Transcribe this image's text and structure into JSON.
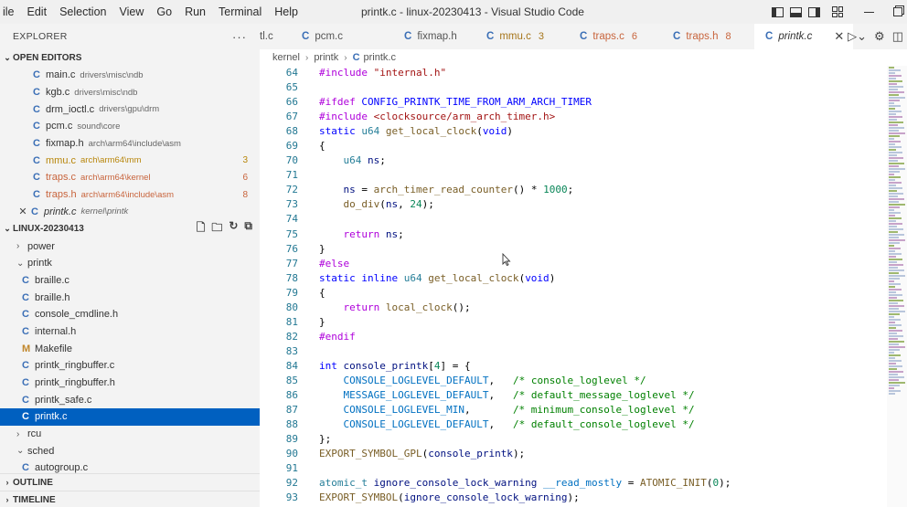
{
  "menu": [
    "ile",
    "Edit",
    "Selection",
    "View",
    "Go",
    "Run",
    "Terminal",
    "Help"
  ],
  "window_title": "printk.c - linux-20230413 - Visual Studio Code",
  "sidebar": {
    "title": "EXPLORER",
    "more": "···",
    "open_editors": {
      "label": "OPEN EDITORS",
      "items": [
        {
          "icon": "C",
          "name": "main.c",
          "path": "drivers\\misc\\ndb",
          "badge": "",
          "state": ""
        },
        {
          "icon": "C",
          "name": "kgb.c",
          "path": "drivers\\misc\\ndb",
          "badge": "",
          "state": ""
        },
        {
          "icon": "C",
          "name": "drm_ioctl.c",
          "path": "drivers\\gpu\\drm",
          "badge": "",
          "state": ""
        },
        {
          "icon": "C",
          "name": "pcm.c",
          "path": "sound\\core",
          "badge": "",
          "state": ""
        },
        {
          "icon": "C",
          "name": "fixmap.h",
          "path": "arch\\arm64\\include\\asm",
          "badge": "",
          "state": ""
        },
        {
          "icon": "C",
          "name": "mmu.c",
          "path": "arch\\arm64\\mm",
          "badge": "3",
          "state": "warn"
        },
        {
          "icon": "C",
          "name": "traps.c",
          "path": "arch\\arm64\\kernel",
          "badge": "6",
          "state": "err"
        },
        {
          "icon": "C",
          "name": "traps.h",
          "path": "arch\\arm64\\include\\asm",
          "badge": "8",
          "state": "err"
        },
        {
          "icon": "C",
          "name": "printk.c",
          "path": "kernel\\printk",
          "badge": "",
          "state": "active",
          "close": "✕"
        }
      ]
    },
    "workspace": {
      "label": "LINUX-20230413",
      "tree": [
        {
          "kind": "folder",
          "name": "power",
          "open": false,
          "depth": 1
        },
        {
          "kind": "folder",
          "name": "printk",
          "open": true,
          "depth": 1
        },
        {
          "kind": "file",
          "icon": "C",
          "name": "braille.c",
          "depth": 2
        },
        {
          "kind": "file",
          "icon": "C",
          "name": "braille.h",
          "depth": 2
        },
        {
          "kind": "file",
          "icon": "C",
          "name": "console_cmdline.h",
          "depth": 2
        },
        {
          "kind": "file",
          "icon": "C",
          "name": "internal.h",
          "depth": 2
        },
        {
          "kind": "file",
          "icon": "M",
          "name": "Makefile",
          "depth": 2
        },
        {
          "kind": "file",
          "icon": "C",
          "name": "printk_ringbuffer.c",
          "depth": 2
        },
        {
          "kind": "file",
          "icon": "C",
          "name": "printk_ringbuffer.h",
          "depth": 2
        },
        {
          "kind": "file",
          "icon": "C",
          "name": "printk_safe.c",
          "depth": 2
        },
        {
          "kind": "file",
          "icon": "C",
          "name": "printk.c",
          "depth": 2,
          "selected": true
        },
        {
          "kind": "folder",
          "name": "rcu",
          "open": false,
          "depth": 1
        },
        {
          "kind": "folder",
          "name": "sched",
          "open": true,
          "depth": 1
        },
        {
          "kind": "file",
          "icon": "C",
          "name": "autogroup.c",
          "depth": 2
        }
      ]
    },
    "outline_label": "OUTLINE",
    "timeline_label": "TIMELINE"
  },
  "tabs": [
    {
      "label": "tl.c",
      "icon": "",
      "badge": "",
      "state": ""
    },
    {
      "label": "pcm.c",
      "icon": "C",
      "badge": "",
      "state": ""
    },
    {
      "label": "fixmap.h",
      "icon": "C",
      "badge": "",
      "state": ""
    },
    {
      "label": "mmu.c",
      "icon": "C",
      "badge": "3",
      "state": "warn"
    },
    {
      "label": "traps.c",
      "icon": "C",
      "badge": "6",
      "state": "err"
    },
    {
      "label": "traps.h",
      "icon": "C",
      "badge": "8",
      "state": "err"
    },
    {
      "label": "printk.c",
      "icon": "C",
      "badge": "",
      "state": "active",
      "close": "✕"
    }
  ],
  "breadcrumb": {
    "parts": [
      "kernel",
      "printk"
    ],
    "file": "printk.c",
    "icon": "C"
  },
  "code": [
    {
      "n": "64",
      "t": [
        [
          "pp",
          "#include "
        ],
        [
          "str",
          "\"internal.h\""
        ]
      ]
    },
    {
      "n": "65",
      "t": []
    },
    {
      "n": "66",
      "t": [
        [
          "pp",
          "#ifdef "
        ],
        [
          "ppname",
          "CONFIG_PRINTK_TIME_FROM_ARM_ARCH_TIMER"
        ]
      ]
    },
    {
      "n": "67",
      "t": [
        [
          "pp",
          "#include "
        ],
        [
          "str",
          "<clocksource/arm_arch_timer.h>"
        ]
      ]
    },
    {
      "n": "68",
      "t": [
        [
          "kw",
          "static "
        ],
        [
          "ty",
          "u64 "
        ],
        [
          "fn",
          "get_local_clock"
        ],
        [
          "plain2",
          "("
        ],
        [
          "kw",
          "void"
        ],
        [
          "plain2",
          ")"
        ]
      ]
    },
    {
      "n": "69",
      "t": [
        [
          "plain2",
          "{"
        ]
      ]
    },
    {
      "n": "70",
      "t": [
        [
          "plain2",
          "    "
        ],
        [
          "ty",
          "u64 "
        ],
        [
          "plain",
          "ns"
        ],
        [
          "plain2",
          ";"
        ]
      ]
    },
    {
      "n": "71",
      "t": []
    },
    {
      "n": "72",
      "t": [
        [
          "plain2",
          "    "
        ],
        [
          "plain",
          "ns"
        ],
        [
          "plain2",
          " = "
        ],
        [
          "fn",
          "arch_timer_read_counter"
        ],
        [
          "plain2",
          "() * "
        ],
        [
          "num",
          "1000"
        ],
        [
          "plain2",
          ";"
        ]
      ]
    },
    {
      "n": "73",
      "t": [
        [
          "plain2",
          "    "
        ],
        [
          "fn",
          "do_div"
        ],
        [
          "plain2",
          "("
        ],
        [
          "plain",
          "ns"
        ],
        [
          "plain2",
          ", "
        ],
        [
          "num",
          "24"
        ],
        [
          "plain2",
          ");"
        ]
      ]
    },
    {
      "n": "74",
      "t": []
    },
    {
      "n": "75",
      "t": [
        [
          "plain2",
          "    "
        ],
        [
          "pp",
          "return "
        ],
        [
          "plain",
          "ns"
        ],
        [
          "plain2",
          ";"
        ]
      ]
    },
    {
      "n": "76",
      "t": [
        [
          "plain2",
          "}"
        ]
      ]
    },
    {
      "n": "77",
      "t": [
        [
          "pp",
          "#else"
        ]
      ]
    },
    {
      "n": "78",
      "t": [
        [
          "kw",
          "static inline "
        ],
        [
          "ty",
          "u64 "
        ],
        [
          "fn",
          "get_local_clock"
        ],
        [
          "plain2",
          "("
        ],
        [
          "kw",
          "void"
        ],
        [
          "plain2",
          ")"
        ]
      ]
    },
    {
      "n": "79",
      "t": [
        [
          "plain2",
          "{"
        ]
      ]
    },
    {
      "n": "80",
      "t": [
        [
          "plain2",
          "    "
        ],
        [
          "pp",
          "return "
        ],
        [
          "fn",
          "local_clock"
        ],
        [
          "plain2",
          "();"
        ]
      ]
    },
    {
      "n": "81",
      "t": [
        [
          "plain2",
          "}"
        ]
      ]
    },
    {
      "n": "82",
      "t": [
        [
          "pp",
          "#endif"
        ]
      ]
    },
    {
      "n": "83",
      "t": []
    },
    {
      "n": "84",
      "t": [
        [
          "kw",
          "int "
        ],
        [
          "plain",
          "console_printk"
        ],
        [
          "plain2",
          "["
        ],
        [
          "num",
          "4"
        ],
        [
          "plain2",
          "] = {"
        ]
      ]
    },
    {
      "n": "85",
      "t": [
        [
          "plain2",
          "    "
        ],
        [
          "macro",
          "CONSOLE_LOGLEVEL_DEFAULT"
        ],
        [
          "plain2",
          ",   "
        ],
        [
          "cmt",
          "/* console_loglevel */"
        ]
      ]
    },
    {
      "n": "86",
      "t": [
        [
          "plain2",
          "    "
        ],
        [
          "macro",
          "MESSAGE_LOGLEVEL_DEFAULT"
        ],
        [
          "plain2",
          ",   "
        ],
        [
          "cmt",
          "/* default_message_loglevel */"
        ]
      ]
    },
    {
      "n": "87",
      "t": [
        [
          "plain2",
          "    "
        ],
        [
          "macro",
          "CONSOLE_LOGLEVEL_MIN"
        ],
        [
          "plain2",
          ",       "
        ],
        [
          "cmt",
          "/* minimum_console_loglevel */"
        ]
      ]
    },
    {
      "n": "88",
      "t": [
        [
          "plain2",
          "    "
        ],
        [
          "macro",
          "CONSOLE_LOGLEVEL_DEFAULT"
        ],
        [
          "plain2",
          ",   "
        ],
        [
          "cmt",
          "/* default_console_loglevel */"
        ]
      ]
    },
    {
      "n": "89",
      "t": [
        [
          "plain2",
          "};"
        ]
      ]
    },
    {
      "n": "90",
      "t": [
        [
          "fn",
          "EXPORT_SYMBOL_GPL"
        ],
        [
          "plain2",
          "("
        ],
        [
          "plain",
          "console_printk"
        ],
        [
          "plain2",
          ");"
        ]
      ]
    },
    {
      "n": "91",
      "t": []
    },
    {
      "n": "92",
      "t": [
        [
          "ty",
          "atomic_t "
        ],
        [
          "plain",
          "ignore_console_lock_warning "
        ],
        [
          "macro",
          "__read_mostly"
        ],
        [
          "plain2",
          " = "
        ],
        [
          "fn",
          "ATOMIC_INIT"
        ],
        [
          "plain2",
          "("
        ],
        [
          "num",
          "0"
        ],
        [
          "plain2",
          ");"
        ]
      ]
    },
    {
      "n": "93",
      "t": [
        [
          "fn",
          "EXPORT_SYMBOL"
        ],
        [
          "plain2",
          "("
        ],
        [
          "plain",
          "ignore_console_lock_warning"
        ],
        [
          "plain2",
          ");"
        ]
      ]
    }
  ],
  "colors": {
    "accent": "#0060c0",
    "warn": "#b8860b",
    "error": "#c8643c"
  }
}
